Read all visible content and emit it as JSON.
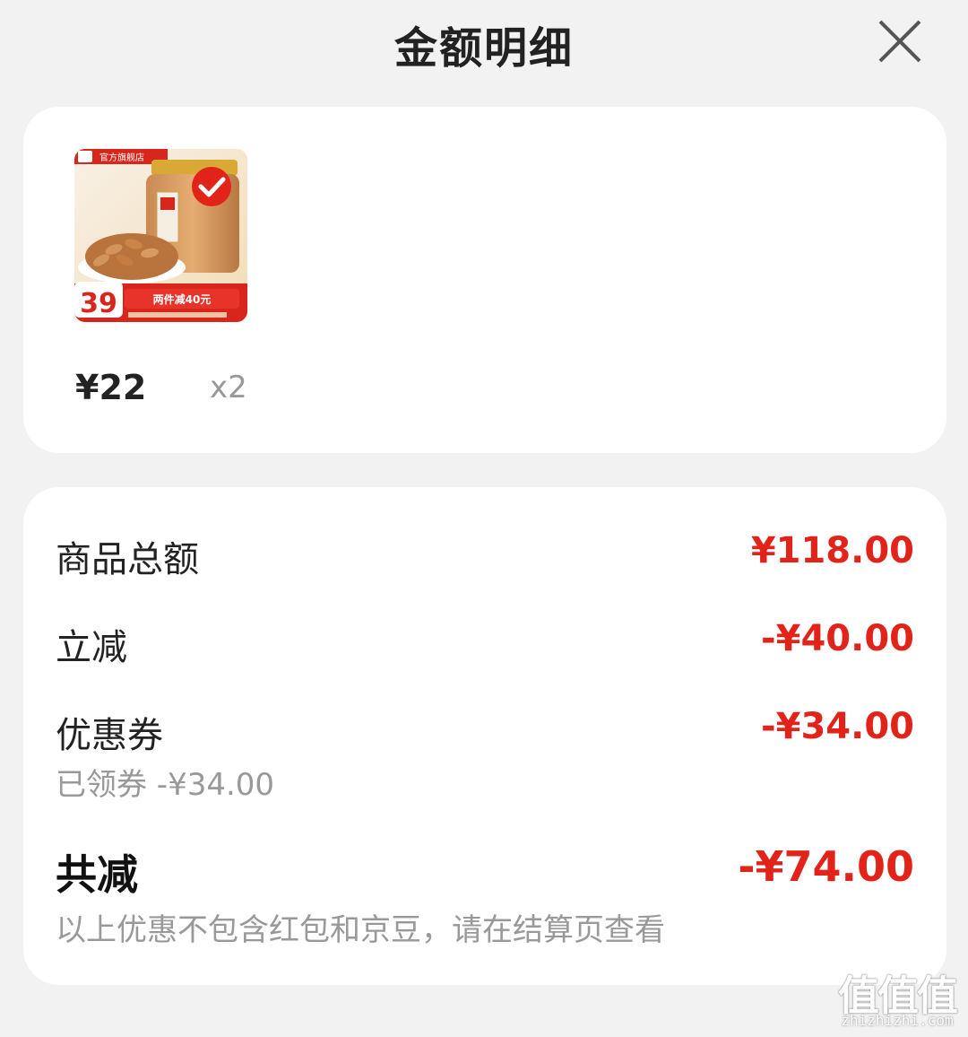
{
  "header": {
    "title": "金额明细",
    "close_icon": "close-icon"
  },
  "product": {
    "image_badges": {
      "store_tag": "官方旗舰店",
      "price_badge": "39",
      "promo_text": "两件减40元"
    },
    "price": "¥22",
    "quantity": "x2"
  },
  "details": {
    "rows": [
      {
        "label": "商品总额",
        "value": "¥118.00"
      },
      {
        "label": "立减",
        "value": "-¥40.00"
      },
      {
        "label": "优惠券",
        "value": "-¥34.00",
        "sub": "已领券 -¥34.00"
      }
    ],
    "total": {
      "label": "共减",
      "value": "-¥74.00",
      "note": "以上优惠不包含红包和京豆，请在结算页查看"
    }
  },
  "watermark": {
    "glyphs": "值值值",
    "url": "zhizhizhi.com"
  },
  "colors": {
    "accent_red": "#e2231a",
    "background": "#f2f2f2",
    "card": "#ffffff"
  }
}
